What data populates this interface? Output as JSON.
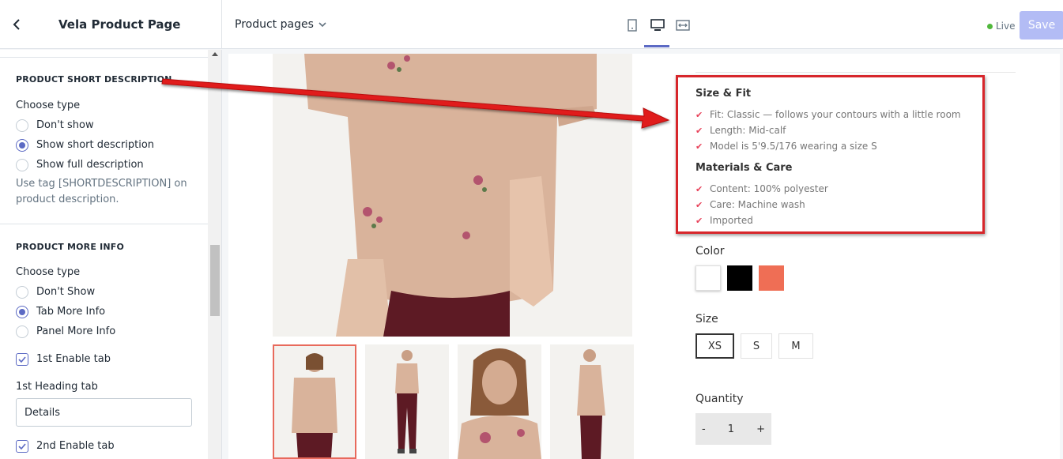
{
  "header": {
    "title": "Vela Product Page",
    "page_select": "Product pages",
    "live_label": "Live",
    "save_label": "Save"
  },
  "sidebar": {
    "short_desc": {
      "title": "PRODUCT SHORT DESCRIPTION",
      "choose_type": "Choose type",
      "options": [
        "Don't show",
        "Show short description",
        "Show full description"
      ],
      "selected": 1,
      "hint": "Use tag [SHORTDESCRIPTION] on product description."
    },
    "more_info": {
      "title": "PRODUCT MORE INFO",
      "choose_type": "Choose type",
      "options": [
        "Don't Show",
        "Tab More Info",
        "Panel More Info"
      ],
      "selected": 1,
      "tab1_enable": "1st Enable tab",
      "tab1_heading_label": "1st Heading tab",
      "tab1_heading_value": "Details",
      "tab2_enable": "2nd Enable tab"
    }
  },
  "product": {
    "size_fit_title": "Size & Fit",
    "size_fit_items": [
      "Fit: Classic — follows your contours with a little room",
      "Length: Mid-calf",
      "Model is 5'9.5/176 wearing a size S"
    ],
    "materials_title": "Materials & Care",
    "materials_items": [
      "Content: 100% polyester",
      "Care: Machine wash",
      "Imported"
    ],
    "color_label": "Color",
    "colors": [
      "#ffffff",
      "#000000",
      "#ef6e55"
    ],
    "size_label": "Size",
    "sizes": [
      "XS",
      "S",
      "M"
    ],
    "quantity_label": "Quantity",
    "qty_minus": "-",
    "qty_value": "1",
    "qty_plus": "+"
  }
}
